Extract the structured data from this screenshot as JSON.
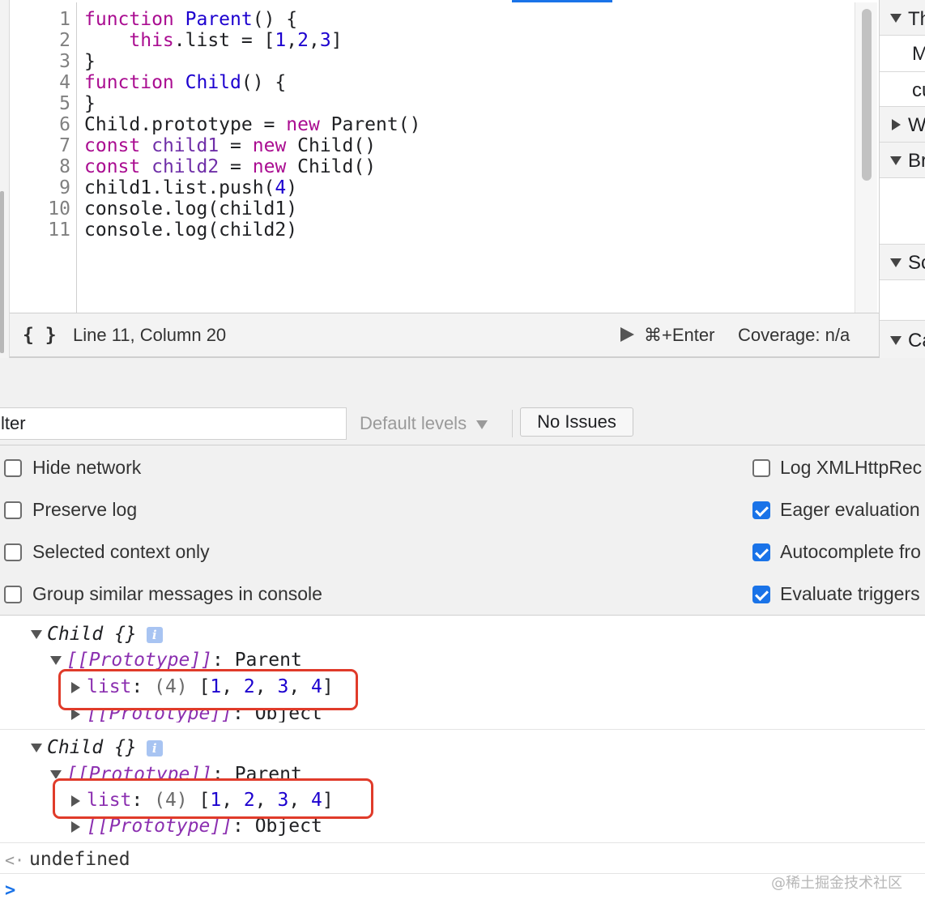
{
  "editor": {
    "line_numbers": [
      "1",
      "2",
      "3",
      "4",
      "5",
      "6",
      "7",
      "8",
      "9",
      "10",
      "11"
    ],
    "code": {
      "l1_kw": "function",
      "l1_fn": "Parent",
      "l1_rest": "() {",
      "l2_kw": "this",
      "l2_mid": ".list = [",
      "l2_n1": "1",
      "l2_n2": "2",
      "l2_n3": "3",
      "l2_end": "]",
      "l3": "}",
      "l4_kw": "function",
      "l4_fn": "Child",
      "l4_rest": "() {",
      "l5": "}",
      "l6_a": "Child.prototype = ",
      "l6_kw": "new",
      "l6_b": " Parent()",
      "l7_kw": "const",
      "l7_var": "child1",
      "l7_eq": " = ",
      "l7_new": "new",
      "l7_b": " Child()",
      "l8_kw": "const",
      "l8_var": "child2",
      "l8_eq": " = ",
      "l8_new": "new",
      "l8_b": " Child()",
      "l9_a": "child1.list.push(",
      "l9_n": "4",
      "l9_b": ")",
      "l10": "console.log(child1)",
      "l11": "console.log(child2)"
    }
  },
  "status_bar": {
    "braces": "{ }",
    "position": "Line 11, Column 20",
    "run_shortcut": "⌘+Enter",
    "coverage": "Coverage: n/a"
  },
  "sidebar": {
    "rows": [
      "Th",
      "M",
      "cu",
      "W",
      "Br",
      "Sc",
      "Ca"
    ]
  },
  "toolbar": {
    "filter_value": "lter",
    "levels_label": "Default levels",
    "issues_label": "No Issues"
  },
  "settings": {
    "left": [
      {
        "label": "Hide network",
        "checked": false
      },
      {
        "label": "Preserve log",
        "checked": false
      },
      {
        "label": "Selected context only",
        "checked": false
      },
      {
        "label": "Group similar messages in console",
        "checked": false
      }
    ],
    "right": [
      {
        "label": "Log XMLHttpRec",
        "checked": false
      },
      {
        "label": "Eager evaluation",
        "checked": true
      },
      {
        "label": "Autocomplete fro",
        "checked": true
      },
      {
        "label": "Evaluate triggers",
        "checked": true
      }
    ]
  },
  "console": {
    "obj_name": "Child {}",
    "info": "i",
    "proto_key": "[[Prototype]]",
    "parent_value": ": Parent",
    "object_value": ": Object",
    "list_key": "list",
    "colon": ": ",
    "list_count": "(4)",
    "list_open": "[",
    "list_values": [
      "1",
      "2",
      "3",
      "4"
    ],
    "list_close": "]",
    "sep": ", ",
    "return_arrow": "<·",
    "return_value": "undefined",
    "prompt": ">"
  },
  "watermark": "@稀土掘金技术社区",
  "colors": {
    "accent": "#1a73e8",
    "highlight_box": "#e03b2a",
    "keyword": "#aa0d91",
    "number": "#1c00cf",
    "property": "#8b2fb0"
  }
}
